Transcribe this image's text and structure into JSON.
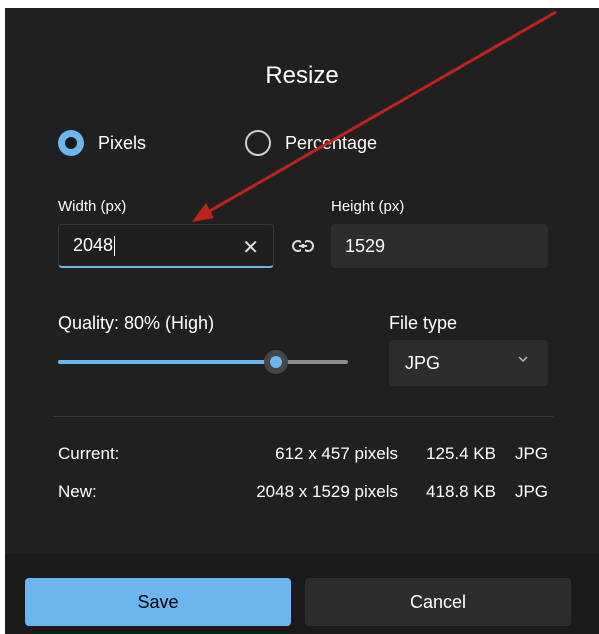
{
  "dialog": {
    "title": "Resize"
  },
  "mode": {
    "options": [
      {
        "label": "Pixels",
        "selected": true
      },
      {
        "label": "Percentage",
        "selected": false
      }
    ]
  },
  "width": {
    "label": "Width  (px)",
    "value": "2048"
  },
  "height": {
    "label": "Height  (px)",
    "value": "1529"
  },
  "quality": {
    "label": "Quality: 80% (High)",
    "percent": 80,
    "slider_fill_fraction": 0.75
  },
  "file_type": {
    "label": "File type",
    "value": "JPG"
  },
  "info": {
    "current": {
      "label": "Current:",
      "dimensions": "612 x 457 pixels",
      "size": "125.4 KB",
      "type": "JPG"
    },
    "new": {
      "label": "New:",
      "dimensions": "2048 x 1529 pixels",
      "size": "418.8 KB",
      "type": "JPG"
    }
  },
  "buttons": {
    "save": "Save",
    "cancel": "Cancel"
  },
  "colors": {
    "accent": "#6cb6f0",
    "background": "#202020",
    "annotation_arrow": "#c0231c"
  },
  "icons": {
    "clear": "close-icon",
    "link": "link-icon",
    "dropdown": "chevron-down-icon"
  }
}
